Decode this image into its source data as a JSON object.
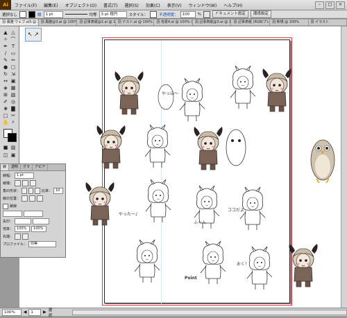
{
  "app": {
    "logo": "Ai"
  },
  "menu": [
    "ファイル(F)",
    "編集(E)",
    "オブジェクト(O)",
    "書式(T)",
    "選択(S)",
    "効果(C)",
    "表示(V)",
    "ウィンドウ(W)",
    "ヘルプ(H)"
  ],
  "window_controls": [
    "–",
    "□",
    "×"
  ],
  "control_bar": {
    "selection_label": "選択なし",
    "stroke_label": "線",
    "stroke_weight": "1 pt",
    "profile_label": "均等",
    "brush_label": "3 pt 楕円",
    "style_label": "スタイル：",
    "opacity_label": "不透明度：",
    "opacity_value": "100",
    "opacity_unit": "%",
    "doc_setup_button": "ドキュメント設定",
    "prefs_button": "環境設定"
  },
  "document_tabs": [
    "羽 風雅 ウェブ.aiS @ 100% (CMYK/プレビュー)",
    "羽 風雅@3.ai @ 100% (CMYK/プレビュー)",
    "羽 記事表紙@2.ai @ 100% (RGB/プレビュー)",
    "羽 テスト.ai @ 100% (CMYK/プレビュー)",
    "羽 背景4.ai @ 100% (CMYK/プレビュー)",
    "羽 記事表紙@3.ai @ 100% (RGB/プレビュー)",
    "羽 記事表紙 (RGB/プレビュー)",
    "羽 新規 @ 100%",
    "羽 イラスト"
  ],
  "stroke_panel": {
    "tabs": [
      "線",
      "透明",
      "グラ",
      "アピア"
    ],
    "weight_label": "線幅：",
    "weight_value": "1 pt",
    "cap_label": "線端：",
    "corner_label": "角の形状：",
    "limit_label": "比率：",
    "limit_value": "10",
    "align_label": "線の位置：",
    "dashed_label": "破線",
    "arrow_label": "矢印：",
    "scale_label": "倍率：",
    "scale_values": [
      "100%",
      "100%"
    ],
    "align_arrow_label": "先端：",
    "profile_label": "プロファイル：",
    "profile_value": "均等"
  },
  "sketch_texts": [
    "やっほ～",
    "やったー♪",
    "ココだよ",
    "ふーん",
    "おく！",
    "Point"
  ],
  "status": {
    "zoom": "100%",
    "page": "1",
    "mode": "選択"
  }
}
